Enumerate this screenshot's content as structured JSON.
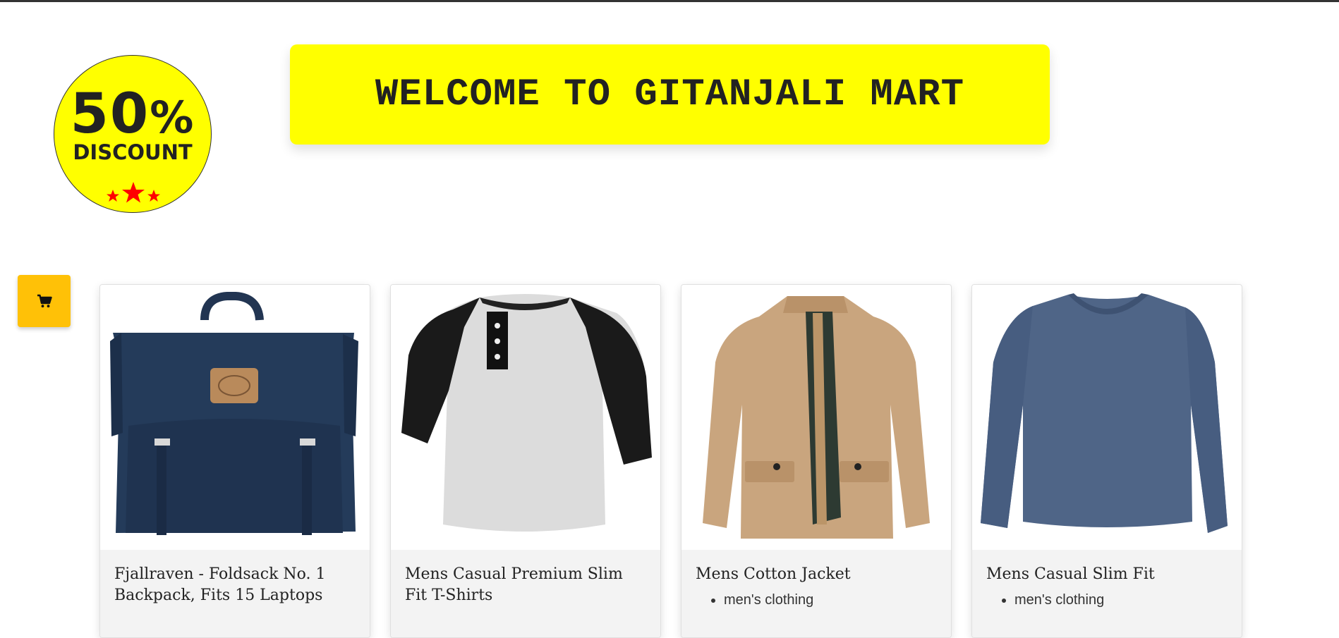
{
  "badge": {
    "number": "50",
    "percent_sign": "%",
    "word": "DISCOUNT",
    "star_color": "#ff0000"
  },
  "welcome": {
    "text": "WELCOME TO GITANJALI MART",
    "background": "#ffff00"
  },
  "cart_button": {
    "icon": "cart-icon",
    "color": "#ffc107"
  },
  "products": [
    {
      "title": "Fjallraven - Foldsack No. 1 Backpack, Fits 15 Laptops",
      "category": "",
      "image": "backpack"
    },
    {
      "title": "Mens Casual Premium Slim Fit T-Shirts",
      "category": "",
      "image": "raglan-tshirt"
    },
    {
      "title": "Mens Cotton Jacket",
      "category": "men's clothing",
      "image": "cotton-jacket"
    },
    {
      "title": "Mens Casual Slim Fit",
      "category": "men's clothing",
      "image": "long-sleeve-tee"
    }
  ]
}
